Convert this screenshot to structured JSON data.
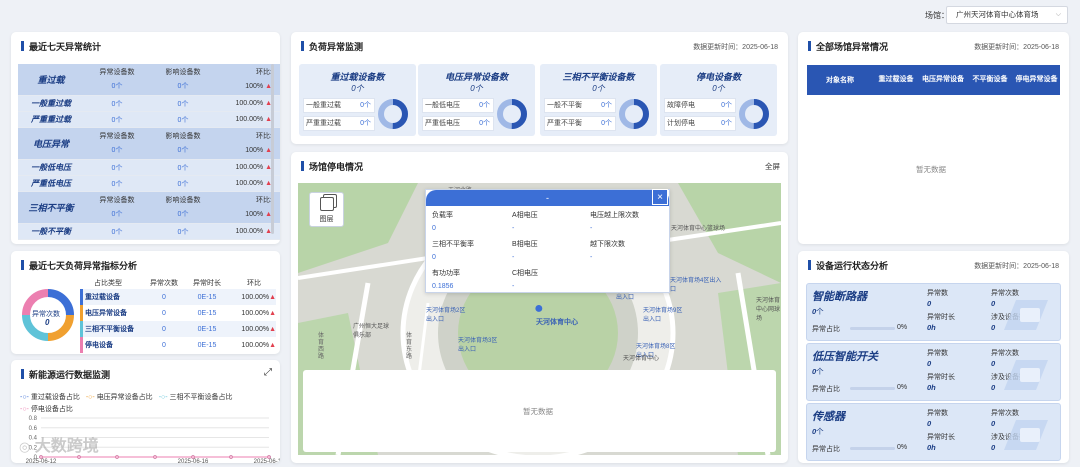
{
  "header": {
    "venue_label": "场馆：",
    "venue_value": "广州天河体育中心体育场"
  },
  "stats7": {
    "title": "最近七天异常统计",
    "col_count": "异常设备数",
    "col_impact": "影响设备数",
    "col_ratio": "环比:",
    "groups": [
      {
        "name": "重过载",
        "head": {
          "count": "0",
          "unit": "个",
          "impact": "0",
          "ratio": "100%"
        },
        "rows": [
          {
            "name": "一般重过载",
            "count": "0",
            "impact": "0",
            "ratio": "100.00%"
          },
          {
            "name": "严重重过载",
            "count": "0",
            "impact": "0",
            "ratio": "100.00%"
          }
        ]
      },
      {
        "name": "电压异常",
        "head": {
          "count": "0",
          "unit": "个",
          "impact": "0",
          "ratio": "100%"
        },
        "rows": [
          {
            "name": "一般低电压",
            "count": "0",
            "impact": "0",
            "ratio": "100.00%"
          },
          {
            "name": "严重低电压",
            "count": "0",
            "impact": "0",
            "ratio": "100.00%"
          }
        ]
      },
      {
        "name": "三相不平衡",
        "head": {
          "count": "0",
          "unit": "个",
          "impact": "0",
          "ratio": "100%"
        },
        "rows": [
          {
            "name": "一般不平衡",
            "count": "0",
            "impact": "0",
            "ratio": "100.00%"
          }
        ]
      }
    ]
  },
  "ratio7": {
    "title": "最近七天负荷异常指标分析",
    "donut_label": "异常次数",
    "donut_value": "0",
    "cols": [
      "占比类型",
      "异常次数",
      "异常时长",
      "环比"
    ],
    "rows": [
      {
        "name": "重过载设备",
        "count": "0",
        "dur": "0E-15",
        "ratio": "100.00%",
        "color": "#3c6fd6"
      },
      {
        "name": "电压异常设备",
        "count": "0",
        "dur": "0E-15",
        "ratio": "100.00%",
        "color": "#f0a030"
      },
      {
        "name": "三相不平衡设备",
        "count": "0",
        "dur": "0E-15",
        "ratio": "100.00%",
        "color": "#5fc3d8"
      },
      {
        "name": "停电设备",
        "count": "0",
        "dur": "0E-15",
        "ratio": "100.00%",
        "color": "#ec7fb0"
      }
    ]
  },
  "newenergy": {
    "title": "新能源运行数据监测",
    "legend": [
      "重过载设备占比",
      "电压异常设备占比",
      "三相不平衡设备占比",
      "停电设备占比"
    ],
    "colors": [
      "#3c6fd6",
      "#f0a030",
      "#5fc3d8",
      "#ec7fb0"
    ],
    "chart_data": {
      "type": "line",
      "x": [
        "2025-06-12",
        "2025-06-13",
        "2025-06-14",
        "2025-06-15",
        "2025-06-16",
        "2025-06-17",
        "2025-06-18"
      ],
      "xticks": [
        "2025-06-12",
        "2025-06-16",
        "2025-06-18"
      ],
      "yticks": [
        "0",
        "0.2",
        "0.4",
        "0.6",
        "0.8"
      ],
      "ylim": [
        0,
        0.8
      ],
      "series": [
        {
          "name": "重过载设备占比",
          "values": [
            0,
            0,
            0,
            0,
            0,
            0,
            0
          ]
        },
        {
          "name": "电压异常设备占比",
          "values": [
            0,
            0,
            0,
            0,
            0,
            0,
            0
          ]
        },
        {
          "name": "三相不平衡设备占比",
          "values": [
            0,
            0,
            0,
            0,
            0,
            0,
            0
          ]
        },
        {
          "name": "停电设备占比",
          "values": [
            0,
            0,
            0,
            0,
            0,
            0,
            0
          ]
        }
      ]
    },
    "watermark": "大数跨境"
  },
  "load": {
    "title": "负荷异常监测",
    "updated": "数据更新时间：2025-06-18",
    "panels": [
      {
        "title": "重过载设备数",
        "value": "0",
        "unit": "个",
        "r1": "一般重过载",
        "v1": "0",
        "r2": "严重重过载",
        "v2": "0"
      },
      {
        "title": "电压异常设备数",
        "value": "0",
        "unit": "个",
        "r1": "一般低电压",
        "v1": "0",
        "r2": "严重低电压",
        "v2": "0"
      },
      {
        "title": "三相不平衡设备数",
        "value": "0",
        "unit": "个",
        "r1": "一般不平衡",
        "v1": "0",
        "r2": "严重不平衡",
        "v2": "0"
      },
      {
        "title": "停电设备数",
        "value": "0",
        "unit": "个",
        "r1": "故障停电",
        "v1": "0",
        "r2": "计划停电",
        "v2": "0"
      }
    ],
    "unit_small": "个"
  },
  "outage": {
    "title": "场馆停电情况",
    "fullscreen": "全屏",
    "layer_label": "图层",
    "popup": {
      "header": "-",
      "items": [
        {
          "label": "负载率",
          "value": "0"
        },
        {
          "label": "A相电压",
          "value": "-"
        },
        {
          "label": "电压越上限次数",
          "value": "-"
        },
        {
          "label": "三相不平衡率",
          "value": "0"
        },
        {
          "label": "B相电压",
          "value": "-"
        },
        {
          "label": "越下限次数",
          "value": "-"
        },
        {
          "label": "有功功率",
          "value": "0.1856"
        },
        {
          "label": "C相电压",
          "value": "-"
        }
      ]
    },
    "close": "×",
    "map_labels": {
      "center": "天河体育中心",
      "l1": "天河体育场2区出入口",
      "l2": "天河体育场3区出入口",
      "l3": "天河体育场4区出入口",
      "l4": "天河体育场9区出入口",
      "l5": "天河体育场8区出入口",
      "l6": "天河体育场7区出入口",
      "l7": "广州恒大足球俱乐部",
      "l8": "天河体育中心篮球场",
      "l9": "天河体育中心网球场",
      "l10": "天河体育中心",
      "r1": "体育西路",
      "r2": "天河北路",
      "r3": "体育东路",
      "r4": "天河东路",
      "r5": "天河东路"
    },
    "empty": "暂无数据"
  },
  "venues": {
    "title": "全部场馆异常情况",
    "updated": "数据更新时间：2025-06-18",
    "cols": [
      "对象名称",
      "重过载设备",
      "电压异常设备",
      "不平衡设备",
      "停电异常设备"
    ],
    "empty": "暂无数据"
  },
  "devices": {
    "title": "设备运行状态分析",
    "updated": "数据更新时间：2025-06-18",
    "items": [
      {
        "name": "智能断路器",
        "count": "0",
        "unit": "个",
        "pct_label": "异常占比",
        "pct": "0%",
        "pct_value": 0,
        "a_lbl": "异常数",
        "a_val": "0",
        "b_lbl": "异常次数",
        "b_val": "0",
        "c_lbl": "异常时长",
        "c_val": "0h",
        "d_lbl": "涉及设备数",
        "d_val": "0"
      },
      {
        "name": "低压智能开关",
        "count": "0",
        "unit": "个",
        "pct_label": "异常占比",
        "pct": "0%",
        "pct_value": 0,
        "a_lbl": "异常数",
        "a_val": "0",
        "b_lbl": "异常次数",
        "b_val": "0",
        "c_lbl": "异常时长",
        "c_val": "0h",
        "d_lbl": "涉及设备数",
        "d_val": "0"
      },
      {
        "name": "传感器",
        "count": "0",
        "unit": "个",
        "pct_label": "异常占比",
        "pct": "0%",
        "pct_value": 0,
        "a_lbl": "异常数",
        "a_val": "0",
        "b_lbl": "异常次数",
        "b_val": "0",
        "c_lbl": "异常时长",
        "c_val": "0h",
        "d_lbl": "涉及设备数",
        "d_val": "0"
      }
    ]
  }
}
